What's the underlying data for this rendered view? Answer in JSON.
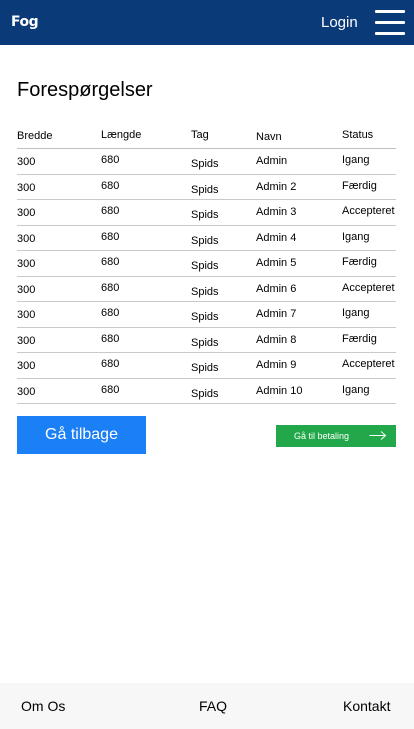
{
  "header": {
    "logo_text": "Fog",
    "login_label": "Login",
    "menu_icon": "hamburger-menu-icon",
    "background": "#0b3a78"
  },
  "page": {
    "title": "Forespørgelser"
  },
  "table": {
    "columns": [
      "Bredde",
      "Længde",
      "Tag",
      "Navn",
      "Status"
    ],
    "rows": [
      [
        "300",
        "680",
        "Spids",
        "Admin",
        "Igang"
      ],
      [
        "300",
        "680",
        "Spids",
        "Admin 2",
        "Færdig"
      ],
      [
        "300",
        "680",
        "Spids",
        "Admin 3",
        "Accepteret"
      ],
      [
        "300",
        "680",
        "Spids",
        "Admin 4",
        "Igang"
      ],
      [
        "300",
        "680",
        "Spids",
        "Admin 5",
        "Færdig"
      ],
      [
        "300",
        "680",
        "Spids",
        "Admin 6",
        "Accepteret"
      ],
      [
        "300",
        "680",
        "Spids",
        "Admin 7",
        "Igang"
      ],
      [
        "300",
        "680",
        "Spids",
        "Admin 8",
        "Færdig"
      ],
      [
        "300",
        "680",
        "Spids",
        "Admin 9",
        "Accepteret"
      ],
      [
        "300",
        "680",
        "Spids",
        "Admin 10",
        "Igang"
      ]
    ]
  },
  "actions": {
    "back_label": "Gå tilbage",
    "back_color": "#1b7ff5",
    "pay_label": "Gå til betaling",
    "pay_icon": "arrow-right-icon",
    "pay_color": "#22a84a"
  },
  "footer": {
    "links": [
      "Om Os",
      "FAQ",
      "Kontakt"
    ]
  }
}
